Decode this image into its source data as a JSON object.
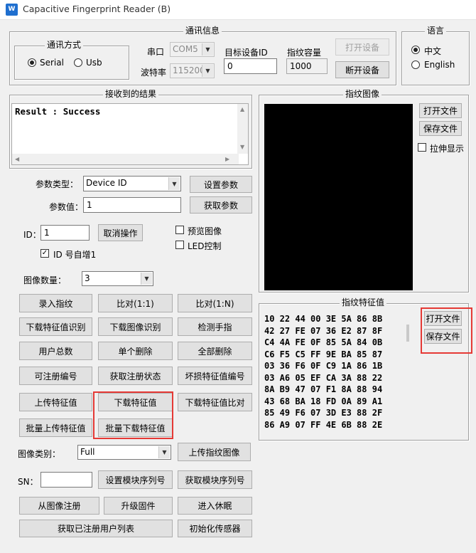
{
  "window": {
    "title": "Capacitive Fingerprint Reader (B)",
    "icon": "app-logo-icon"
  },
  "comm": {
    "group_title": "通讯信息",
    "mode": {
      "title": "通讯方式",
      "options": [
        "Serial",
        "Usb"
      ],
      "selected": "Serial"
    },
    "port_label": "串口",
    "port_value": "COM5",
    "baud_label": "波特率",
    "baud_value": "115200",
    "target_id_label": "目标设备ID",
    "target_id_value": "0",
    "capacity_label": "指纹容量",
    "capacity_value": "1000",
    "open_btn": "打开设备",
    "close_btn": "断开设备"
  },
  "language": {
    "title": "语言",
    "options": [
      "中文",
      "English"
    ],
    "selected": "中文"
  },
  "result": {
    "title": "接收到的结果",
    "text": "Result : Success"
  },
  "image_panel": {
    "title": "指纹图像",
    "open_btn": "打开文件",
    "save_btn": "保存文件",
    "stretch_label": "拉伸显示",
    "stretch_checked": false
  },
  "params": {
    "type_label": "参数类型：",
    "type_value": "Device ID",
    "set_btn": "设置参数",
    "value_label": "参数值：",
    "value": "1",
    "get_btn": "获取参数"
  },
  "id_row": {
    "label": "ID：",
    "value": "1",
    "cancel_btn": "取消操作",
    "auto_inc_label": "ID 号自增1",
    "auto_inc_checked": true
  },
  "preview_label": "预览图像",
  "led_label": "LED控制",
  "image_count": {
    "label": "图像数量：",
    "value": "3"
  },
  "buttons": [
    [
      "录入指纹",
      "比对(1:1)",
      "比对(1:N)"
    ],
    [
      "下载特征值识别",
      "下载图像识别",
      "检测手指"
    ],
    [
      "用户总数",
      "单个删除",
      "全部删除"
    ],
    [
      "可注册编号",
      "获取注册状态",
      "坏损特征值编号"
    ],
    [
      "上传特征值",
      "下载特征值",
      "下载特征值比对"
    ],
    [
      "批量上传特征值",
      "批量下载特征值"
    ]
  ],
  "image_type": {
    "label": "图像类别：",
    "value": "Full",
    "upload_btn": "上传指纹图像"
  },
  "sn": {
    "label": "SN：",
    "value": "",
    "set_btn": "设置模块序列号",
    "get_btn": "获取模块序列号"
  },
  "bottom_buttons": [
    [
      "从图像注册",
      "升级固件",
      "进入休眠"
    ],
    [
      "获取已注册用户列表",
      "初始化传感器"
    ]
  ],
  "feature": {
    "title": "指纹特征值",
    "open_btn": "打开文件",
    "save_btn": "保存文件",
    "hex_lines": [
      "10 22 44 00 3E 5A 86 8B",
      "42 27 FE 07 36 E2 87 8F",
      "C4 4A FE 0F 85 5A 84 0B",
      "C6 F5 C5 FF 9E BA 85 87",
      "03 36 F6 0F C9 1A 86 1B",
      "03 A6 05 EF CA 3A 88 22",
      "8A B9 47 07 F1 8A 88 94",
      "43 68 BA 18 FD 0A 89 A1",
      "85 49 F6 07 3D E3 88 2F",
      "86 A9 07 FF 4E 6B 88 2E"
    ]
  },
  "highlight_color": "#e53935"
}
